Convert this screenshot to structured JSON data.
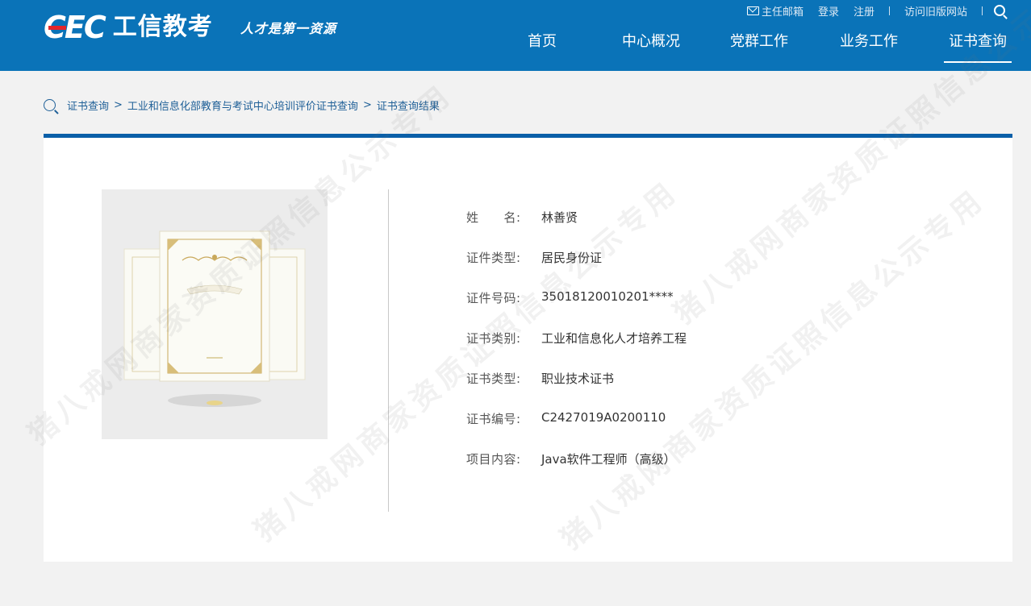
{
  "header": {
    "logo_cec": "CEC",
    "logo_name": "工信教考",
    "slogan": "人才是第一资源",
    "toplinks": {
      "mailbox": "主任邮箱",
      "login": "登录",
      "register": "注册",
      "old_site": "访问旧版网站"
    },
    "nav": [
      {
        "label": "首页"
      },
      {
        "label": "中心概况"
      },
      {
        "label": "党群工作"
      },
      {
        "label": "业务工作"
      },
      {
        "label": "证书查询"
      }
    ]
  },
  "breadcrumb": {
    "items": [
      {
        "label": "证书查询"
      },
      {
        "label": "工业和信息化部教育与考试中心培训评价证书查询"
      },
      {
        "label": "证书查询结果"
      }
    ],
    "separator": ">"
  },
  "result": {
    "fields": [
      {
        "label": "姓　　名:",
        "value": "林善贤"
      },
      {
        "label": "证件类型:",
        "value": "居民身份证"
      },
      {
        "label": "证件号码:",
        "value": "35018120010201****"
      },
      {
        "label": "证书类别:",
        "value": "工业和信息化人才培养工程"
      },
      {
        "label": "证书类型:",
        "value": "职业技术证书"
      },
      {
        "label": "证书编号:",
        "value": "C2427019A0200110"
      },
      {
        "label": "项目内容:",
        "value": "Java软件工程师（高级）"
      }
    ]
  },
  "watermark": "猪八戒网商家资质证照信息公示专用",
  "colors": {
    "header_bg": "#0a73b8",
    "panel_top_border": "#0a5fa8",
    "brand_red": "#e3262a",
    "breadcrumb_text": "#1e5f97"
  }
}
